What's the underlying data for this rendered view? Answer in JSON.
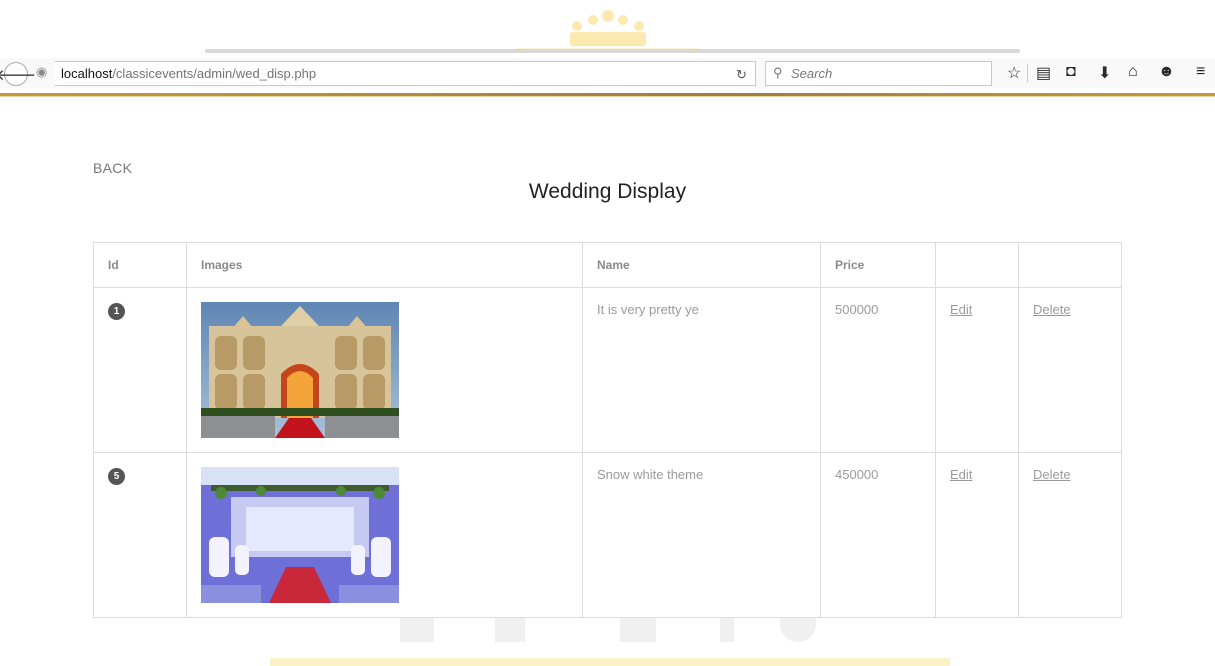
{
  "browser": {
    "url_host": "localhost",
    "url_path": "/classicevents/admin/wed_disp.php",
    "search_placeholder": "Search"
  },
  "page": {
    "back_label": "BACK",
    "title": "Wedding Display"
  },
  "table": {
    "headers": [
      "Id",
      "Images",
      "Name",
      "Price",
      "",
      ""
    ],
    "rows": [
      {
        "id": "1",
        "name": "It is very pretty ye",
        "price": "500000",
        "edit": "Edit",
        "delete": "Delete"
      },
      {
        "id": "5",
        "name": "Snow white theme",
        "price": "450000",
        "edit": "Edit",
        "delete": "Delete"
      }
    ]
  },
  "colors": {
    "accent_gold": "#c79a3f",
    "badge": "#555555"
  }
}
